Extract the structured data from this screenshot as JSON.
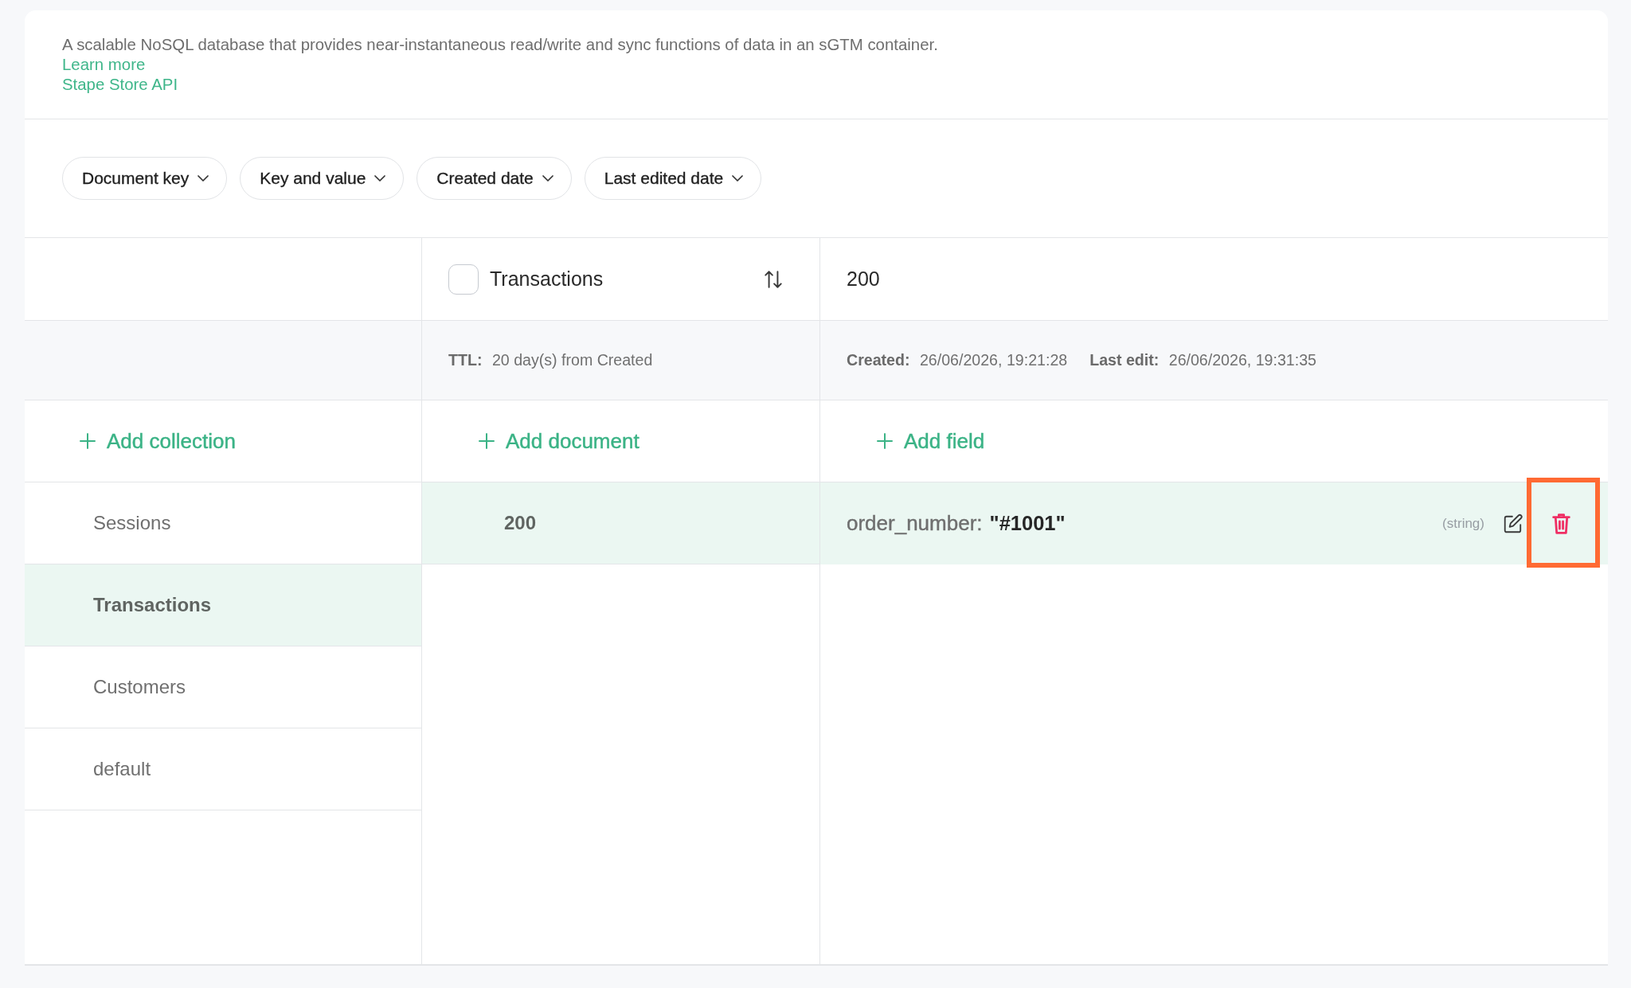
{
  "description": {
    "text": "A scalable NoSQL database that provides near-instantaneous read/write and sync functions of data in an sGTM container.",
    "links": [
      "Learn more",
      "Stape Store API"
    ]
  },
  "filters": [
    {
      "label": "Document key"
    },
    {
      "label": "Key and value"
    },
    {
      "label": "Created date"
    },
    {
      "label": "Last edited date"
    }
  ],
  "collections": {
    "add_label": "Add collection",
    "items": [
      {
        "name": "Sessions",
        "selected": false
      },
      {
        "name": "Transactions",
        "selected": true
      },
      {
        "name": "Customers",
        "selected": false
      },
      {
        "name": "default",
        "selected": false
      }
    ]
  },
  "documents": {
    "header": {
      "title": "Transactions",
      "checked": false
    },
    "ttl": {
      "label": "TTL:",
      "value": "20 day(s) from Created"
    },
    "add_label": "Add document",
    "items": [
      {
        "key": "200",
        "selected": true
      }
    ]
  },
  "fields": {
    "header": {
      "title": "200"
    },
    "meta": [
      {
        "label": "Created:",
        "value": "26/06/2026, 19:21:28"
      },
      {
        "label": "Last edit:",
        "value": "26/06/2026, 19:31:35"
      }
    ],
    "add_label": "Add field",
    "items": [
      {
        "key": "order_number:",
        "value": "\"#1001\"",
        "type": "(string)",
        "selected": true,
        "delete_highlighted": true
      }
    ]
  }
}
